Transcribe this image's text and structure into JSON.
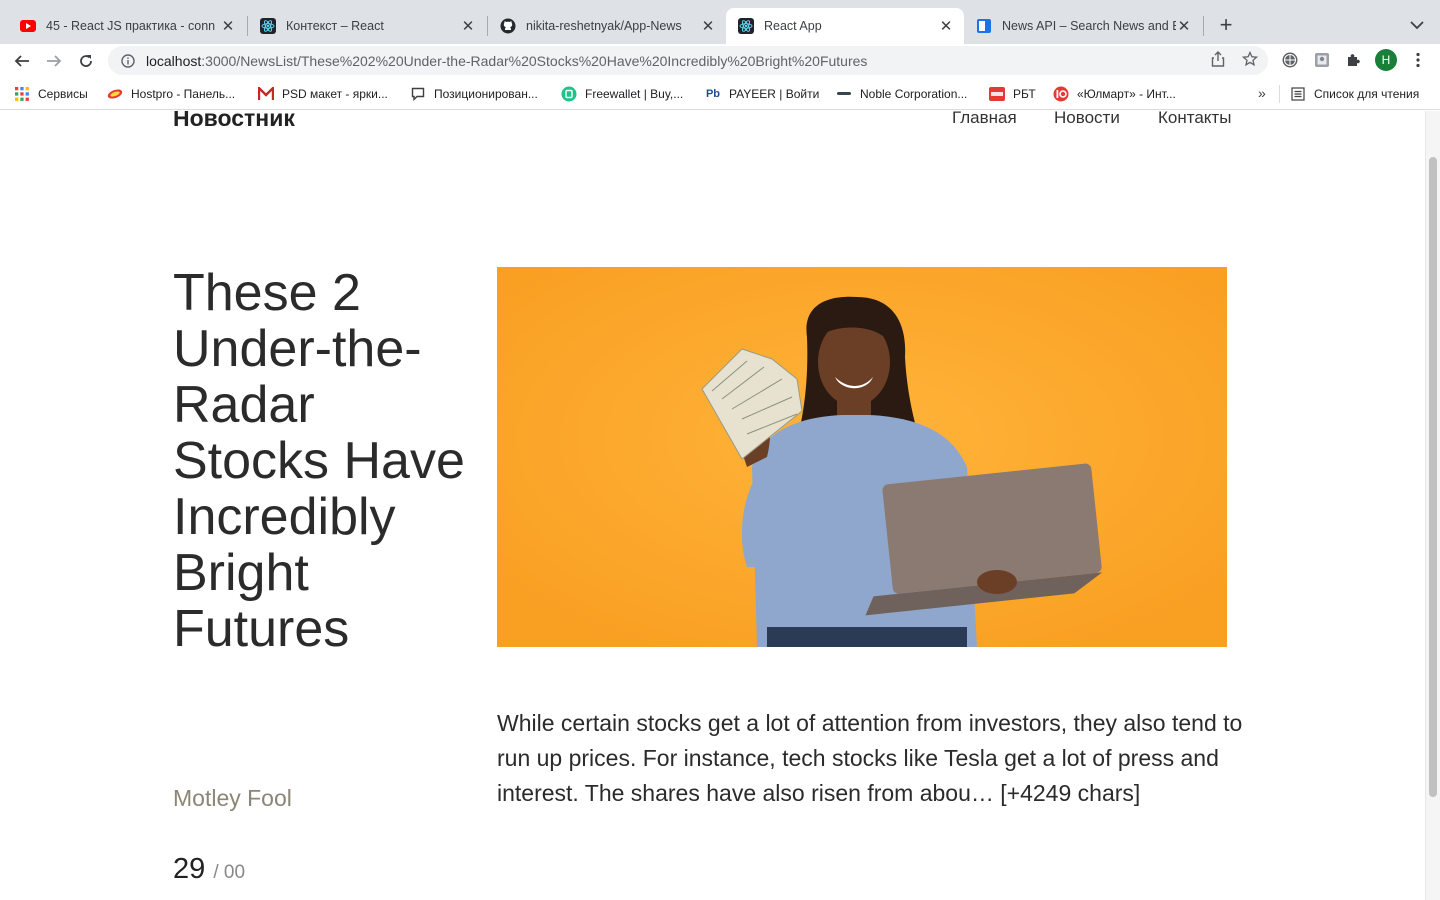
{
  "browser": {
    "tabs": [
      {
        "title": "45 - React JS практика - conn",
        "favicon": "youtube-icon",
        "active": false
      },
      {
        "title": "Контекст – React",
        "favicon": "react-icon",
        "active": false
      },
      {
        "title": "nikita-reshetnyak/App-News",
        "favicon": "github-icon",
        "active": false
      },
      {
        "title": "React App",
        "favicon": "react-icon",
        "active": true
      },
      {
        "title": "News API – Search News and B",
        "favicon": "newsapi-icon",
        "active": false
      }
    ],
    "url_host": "localhost",
    "url_path": ":3000/NewsList/These%202%20Under-the-Radar%20Stocks%20Have%20Incredibly%20Bright%20Futures",
    "profile_initial": "H"
  },
  "bookmarks": {
    "items": [
      {
        "label": "Сервисы",
        "icon": "apps-grid-icon"
      },
      {
        "label": "Hostpro - Панель...",
        "icon": "hostpro-icon"
      },
      {
        "label": "PSD макет - ярки...",
        "icon": "psd-icon"
      },
      {
        "label": "Позиционирован...",
        "icon": "chat-icon"
      },
      {
        "label": "Freewallet | Buy,...",
        "icon": "freewallet-icon"
      },
      {
        "label": "PAYEER | Войти",
        "icon": "payeer-icon"
      },
      {
        "label": "Noble Corporation...",
        "icon": "noble-icon"
      },
      {
        "label": "РБТ",
        "icon": "rbt-icon"
      },
      {
        "label": "«Юлмарт» - Инт...",
        "icon": "ulmart-icon"
      }
    ],
    "more": "»",
    "reading_list": "Список для чтения"
  },
  "site": {
    "logo": "Новостник",
    "nav": [
      "Главная",
      "Новости",
      "Контакты"
    ]
  },
  "article": {
    "title": "These 2 Under-the-Radar Stocks Have Incredibly Bright Futures",
    "source": "Motley Fool",
    "page_current": "29",
    "page_total": "/ 00",
    "description": "While certain stocks get a lot of attention from investors, they also tend to run up prices. For instance, tech stocks like Tesla get a lot of press and interest. The shares have also risen from abou… [+4249 chars]",
    "image_bg": "#fcaa2c"
  }
}
